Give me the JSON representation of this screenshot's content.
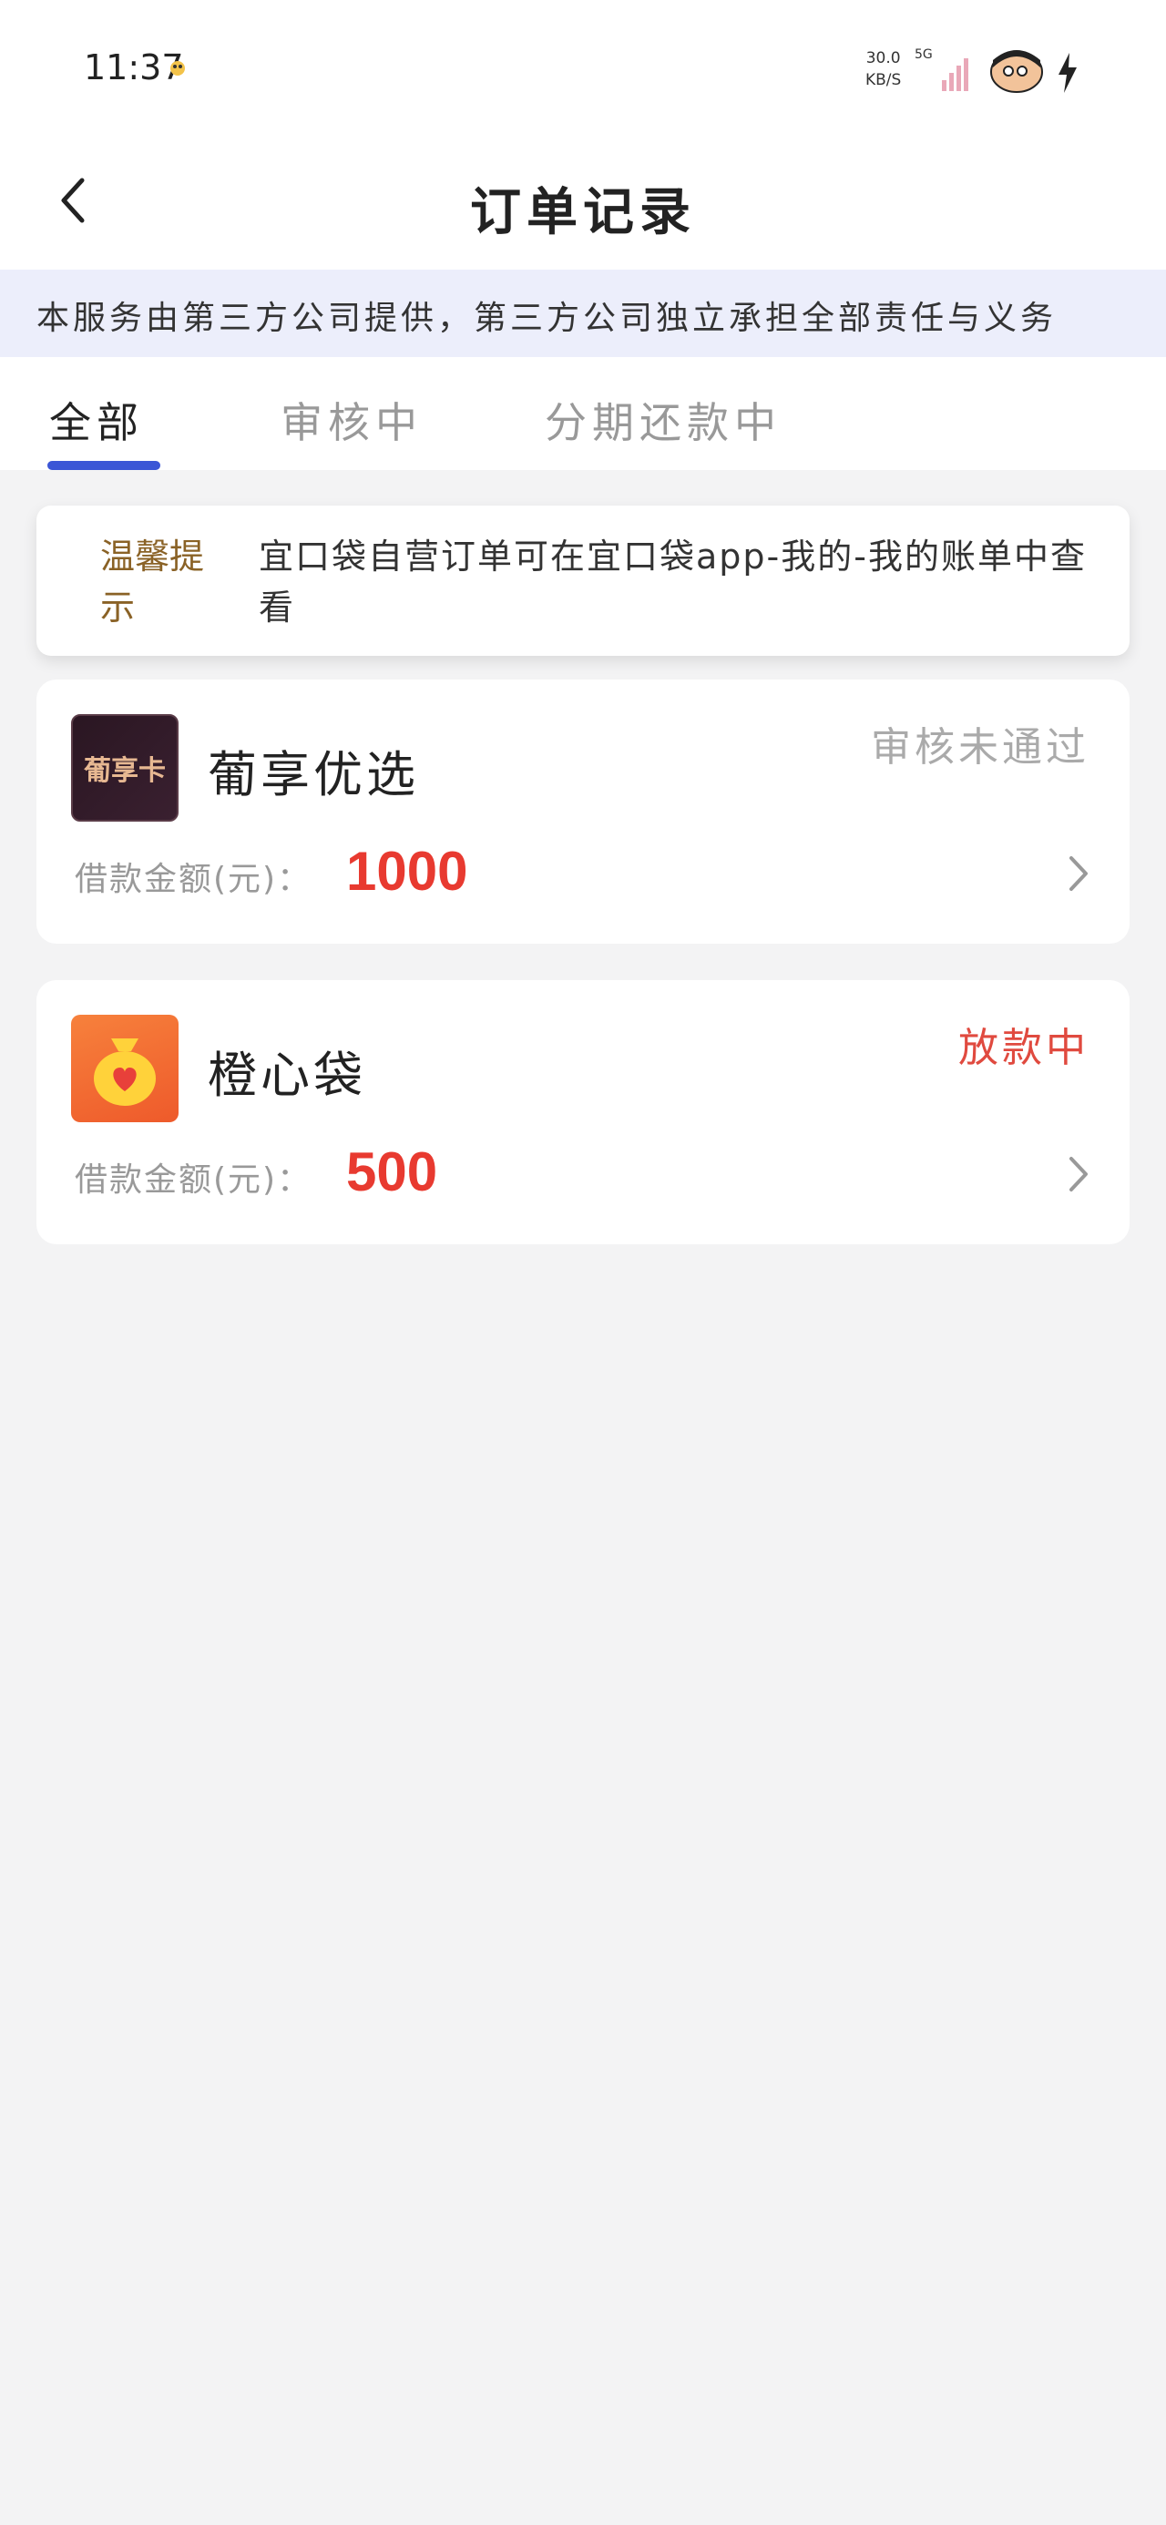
{
  "status_bar": {
    "time": "11:37",
    "net_speed_value": "30.0",
    "net_speed_unit": "KB/S",
    "network": "5G"
  },
  "header": {
    "title": "订单记录"
  },
  "notice": {
    "text": "本服务由第三方公司提供，第三方公司独立承担全部责任与义务"
  },
  "tabs": [
    {
      "label": "全部",
      "active": true
    },
    {
      "label": "审核中",
      "active": false
    },
    {
      "label": "分期还款中",
      "active": false
    }
  ],
  "tip": {
    "label": "温馨提示",
    "text": "宜口袋自营订单可在宜口袋app-我的-我的账单中查看"
  },
  "orders": [
    {
      "name": "葡享优选",
      "logo_text": "葡享卡",
      "status": "审核未通过",
      "status_color": "#aaaaaa",
      "amount_label": "借款金额(元)：",
      "amount": "1000"
    },
    {
      "name": "橙心袋",
      "logo_text": "",
      "status": "放款中",
      "status_color": "#e04a3f",
      "amount_label": "借款金额(元)：",
      "amount": "500"
    }
  ],
  "colors": {
    "accent": "#3b56d6",
    "amount": "#e83a30",
    "tip_label": "#8a6226",
    "notice_bg": "#eceefb"
  }
}
